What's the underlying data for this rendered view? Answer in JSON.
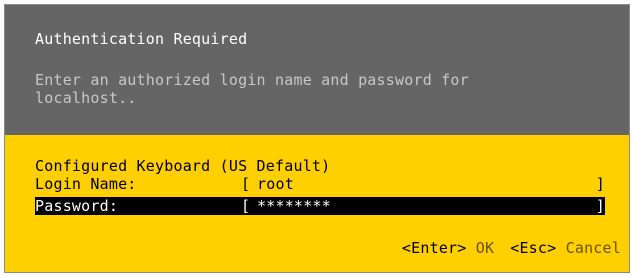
{
  "dialog": {
    "title": "Authentication Required",
    "description_line1": "Enter an authorized login name and password for",
    "description_line2": "localhost..",
    "keyboard_label": "Configured Keyboard (US Default)",
    "login": {
      "label": "Login Name:",
      "bracket_open": "[",
      "value": "root",
      "bracket_close": "]"
    },
    "password": {
      "label": "Password:",
      "bracket_open": "[",
      "value": "********",
      "bracket_close": "]"
    },
    "actions": {
      "enter_key": "<Enter>",
      "enter_label": "OK",
      "esc_key": "<Esc>",
      "esc_label": "Cancel"
    }
  },
  "colors": {
    "header_bg": "#656565",
    "body_bg": "#ffcf00",
    "selected_row_bg": "#000000"
  }
}
